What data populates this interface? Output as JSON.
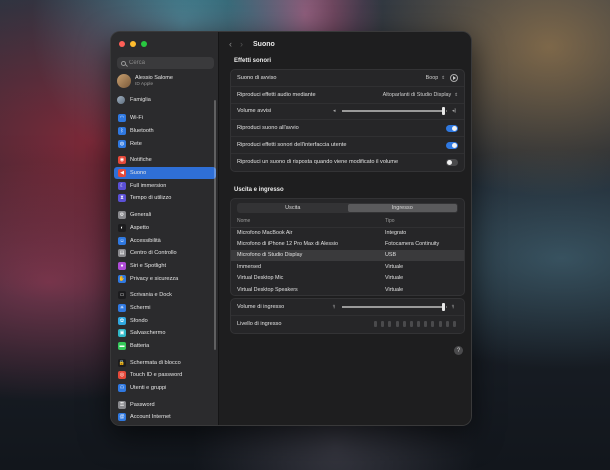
{
  "window": {
    "traffic_colors": [
      "#ff5f57",
      "#febc2e",
      "#28c840"
    ]
  },
  "sidebar": {
    "search_placeholder": "Cerca",
    "account": {
      "name": "Alessio Salome",
      "subtitle": "ID Apple"
    },
    "family": "Famiglia",
    "groups": [
      [
        {
          "label": "Wi-Fi",
          "icon": "wifi-icon",
          "color": "#2f78e0",
          "glyph": "◠"
        },
        {
          "label": "Bluetooth",
          "icon": "bluetooth-icon",
          "color": "#2f78e0",
          "glyph": "ᛒ"
        },
        {
          "label": "Rete",
          "icon": "globe-icon",
          "color": "#2f78e0",
          "glyph": "◍"
        }
      ],
      [
        {
          "label": "Notifiche",
          "icon": "bell-icon",
          "color": "#e5493a",
          "glyph": "◉"
        },
        {
          "label": "Suono",
          "icon": "speaker-icon",
          "color": "#e5493a",
          "glyph": "◀",
          "active": true
        },
        {
          "label": "Full immersion",
          "icon": "moon-icon",
          "color": "#5b50d6",
          "glyph": "☾"
        },
        {
          "label": "Tempo di utilizzo",
          "icon": "hourglass-icon",
          "color": "#5b50d6",
          "glyph": "⧗"
        }
      ],
      [
        {
          "label": "Generali",
          "icon": "gear-icon",
          "color": "#8a8a8e",
          "glyph": "⚙"
        },
        {
          "label": "Aspetto",
          "icon": "appearance-icon",
          "color": "#1c1c1e",
          "glyph": "◐"
        },
        {
          "label": "Accessibilità",
          "icon": "accessibility-icon",
          "color": "#2f78e0",
          "glyph": "☺"
        },
        {
          "label": "Centro di Controllo",
          "icon": "control-center-icon",
          "color": "#8a8a8e",
          "glyph": "▤"
        },
        {
          "label": "Siri e Spotlight",
          "icon": "siri-icon",
          "color": "#b04cd8",
          "glyph": "●"
        },
        {
          "label": "Privacy e sicurezza",
          "icon": "hand-icon",
          "color": "#2f78e0",
          "glyph": "✋"
        }
      ],
      [
        {
          "label": "Scrivania e Dock",
          "icon": "dock-icon",
          "color": "#1c1c1e",
          "glyph": "▭"
        },
        {
          "label": "Schermi",
          "icon": "display-icon",
          "color": "#2f78e0",
          "glyph": "☀"
        },
        {
          "label": "Sfondo",
          "icon": "wallpaper-icon",
          "color": "#30a8e0",
          "glyph": "✿"
        },
        {
          "label": "Salvaschermo",
          "icon": "screensaver-icon",
          "color": "#30b8c8",
          "glyph": "▣"
        },
        {
          "label": "Batteria",
          "icon": "battery-icon",
          "color": "#34c759",
          "glyph": "▬"
        }
      ],
      [
        {
          "label": "Schermata di blocco",
          "icon": "lock-icon",
          "color": "#1c1c1e",
          "glyph": "🔒"
        },
        {
          "label": "Touch ID e password",
          "icon": "fingerprint-icon",
          "color": "#e5493a",
          "glyph": "◎"
        },
        {
          "label": "Utenti e gruppi",
          "icon": "users-icon",
          "color": "#2f78e0",
          "glyph": "⚇"
        }
      ],
      [
        {
          "label": "Password",
          "icon": "key-icon",
          "color": "#8a8a8e",
          "glyph": "⚿"
        },
        {
          "label": "Account Internet",
          "icon": "at-icon",
          "color": "#2f78e0",
          "glyph": "@"
        }
      ]
    ]
  },
  "header": {
    "title": "Suono",
    "back": "‹",
    "forward": "›"
  },
  "effects": {
    "title": "Effetti sonori",
    "alert_sound_label": "Suono di avviso",
    "alert_sound_value": "Boop",
    "play_effects_label": "Riproduci effetti audio mediante",
    "play_effects_value": "Altoparlanti di Studio Display",
    "alert_volume_label": "Volume avvisi",
    "alert_volume_level": 0.95,
    "startup_label": "Riproduci suono all'avvio",
    "startup_on": true,
    "ui_sounds_label": "Riproduci effetti sonori dell'interfaccia utente",
    "ui_sounds_on": true,
    "feedback_label": "Riproduci un suono di risposta quando viene modificato il volume",
    "feedback_on": false
  },
  "io": {
    "title": "Uscita e ingresso",
    "tabs": [
      "Uscita",
      "Ingresso"
    ],
    "selected_tab": 1,
    "columns": [
      "Nome",
      "Tipo"
    ],
    "devices": [
      {
        "name": "Microfono MacBook Air",
        "type": "Integrato"
      },
      {
        "name": "Microfono di iPhone 12 Pro Max di Alessio",
        "type": "Fotocamera Continuity"
      },
      {
        "name": "Microfono di Studio Display",
        "type": "USB",
        "selected": true
      },
      {
        "name": "Immersed",
        "type": "Virtuale"
      },
      {
        "name": "Virtual Desktop Mic",
        "type": "Virtuale"
      },
      {
        "name": "Virtual Desktop Speakers",
        "type": "Virtuale"
      }
    ],
    "input_volume_label": "Volume di ingresso",
    "input_volume_level": 0.95,
    "input_level_label": "Livello di ingresso"
  },
  "help_glyph": "?"
}
